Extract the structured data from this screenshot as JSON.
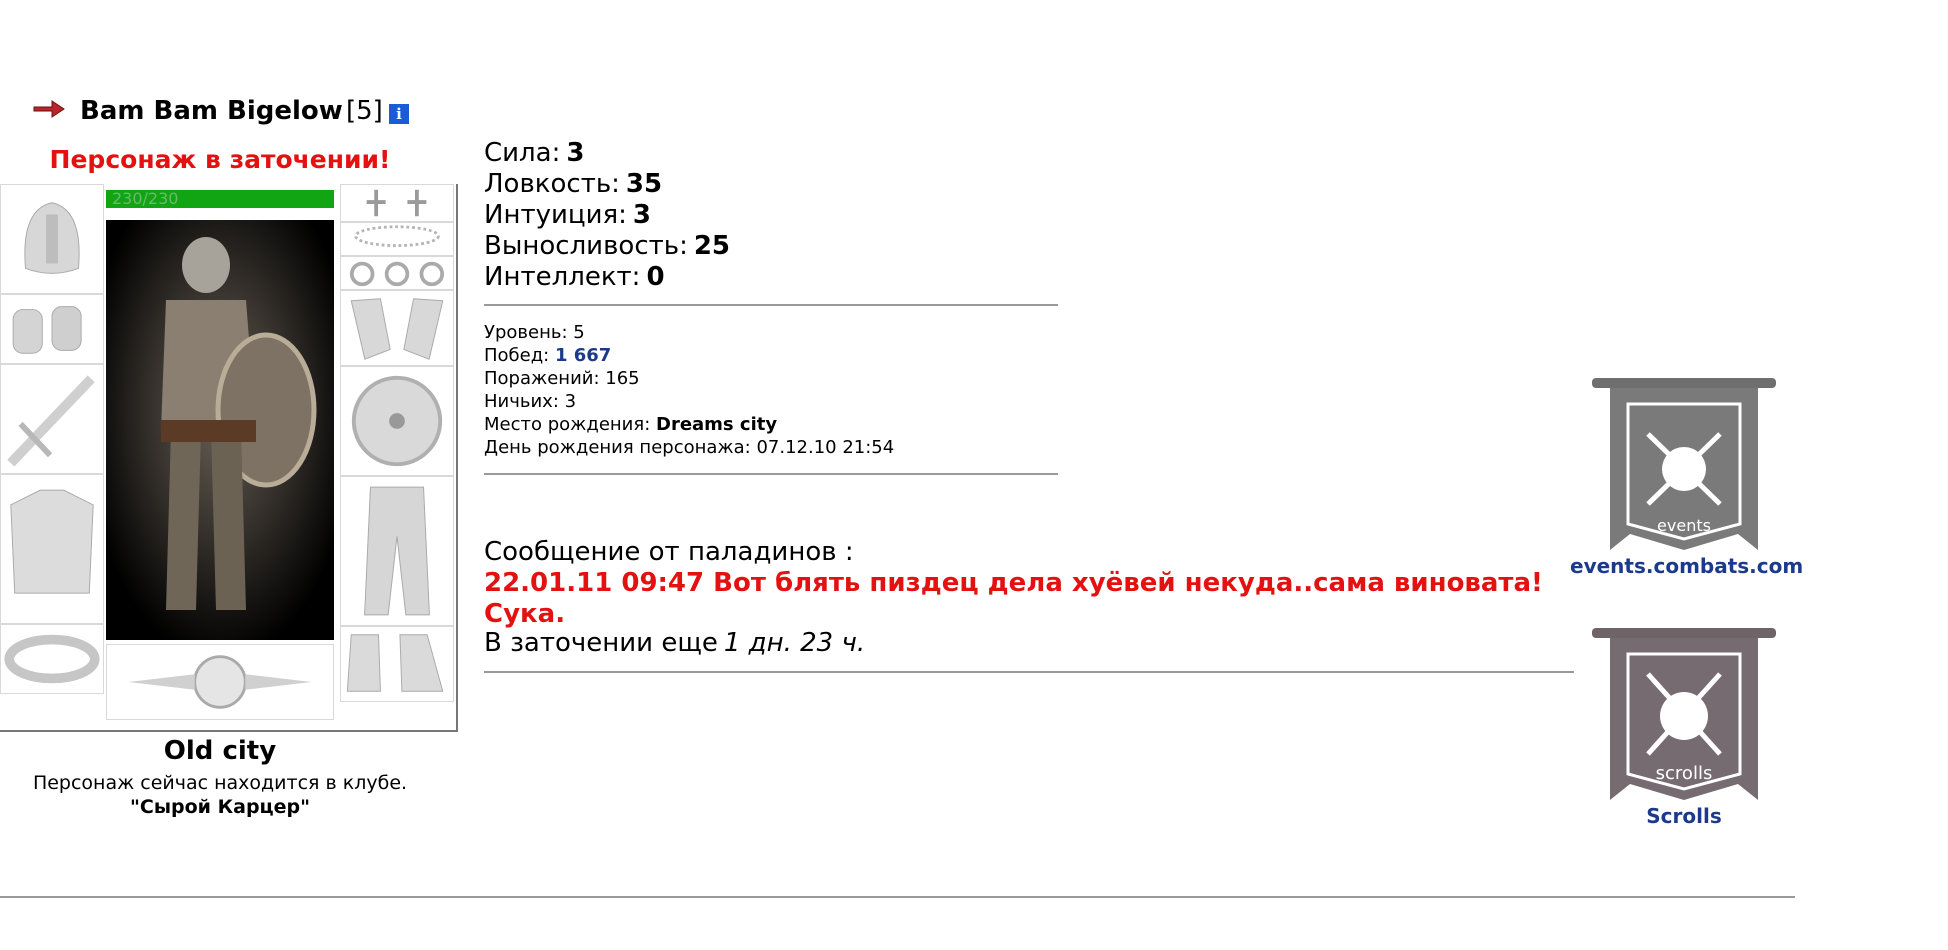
{
  "header": {
    "name": "Bam Bam Bigelow",
    "level": "[5]",
    "info_icon_glyph": "i"
  },
  "jail_notice": "Персонаж в заточении!",
  "hp": "230/230",
  "location": {
    "city": "Old city",
    "club_line": "Персонаж сейчас находится в клубе.",
    "club_name": "\"Сырой Карцер\""
  },
  "stats": [
    {
      "label": "Сила:",
      "value": "3"
    },
    {
      "label": "Ловкость:",
      "value": "35"
    },
    {
      "label": "Интуиция:",
      "value": "3"
    },
    {
      "label": "Выносливость:",
      "value": "25"
    },
    {
      "label": "Интеллект:",
      "value": "0"
    }
  ],
  "info": {
    "level_label": "Уровень:",
    "level_value": "5",
    "wins_label": "Побед:",
    "wins_value": "1 667",
    "losses_label": "Поражений:",
    "losses_value": "165",
    "draws_label": "Ничьих:",
    "draws_value": "3",
    "birthplace_label": "Место рождения:",
    "birthplace_value": "Dreams city",
    "birthday_label": "День рождения персонажа:",
    "birthday_value": "07.12.10 21:54"
  },
  "paladin_message": {
    "title": "Сообщение от паладинов :",
    "text": "22.01.11 09:47 Вот блять пиздец дела хуёвей некуда..сама виновата! Сука.",
    "remaining_label": "В заточении еще",
    "remaining_value": "1 дн. 23 ч."
  },
  "banners": [
    {
      "caption": "events",
      "link": "events.combats.com",
      "icon": "events-fist-banner-icon"
    },
    {
      "caption": "scrolls",
      "link": "Scrolls",
      "icon": "scrolls-fist-banner-icon"
    }
  ],
  "colors": {
    "alert": "#e41111",
    "link": "#1b3a8a",
    "hp": "#11a514",
    "info_icon": "#1a5bd6"
  }
}
